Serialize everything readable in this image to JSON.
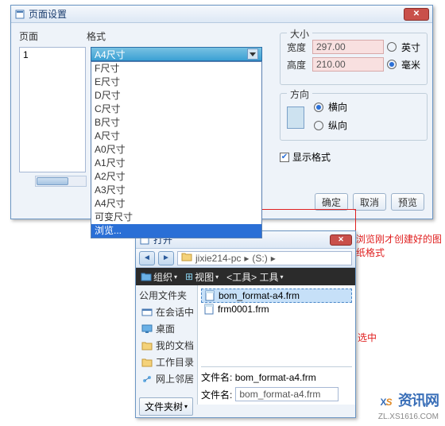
{
  "win1": {
    "title": "页面设置",
    "labels": {
      "page": "页面",
      "format": "格式"
    },
    "page_list": [
      "1"
    ],
    "selected_format": "A4尺寸",
    "dropdown": [
      "F尺寸",
      "E尺寸",
      "D尺寸",
      "C尺寸",
      "B尺寸",
      "A尺寸",
      "A0尺寸",
      "A1尺寸",
      "A2尺寸",
      "A3尺寸",
      "A4尺寸",
      "可变尺寸",
      "浏览..."
    ],
    "size": {
      "legend": "大小",
      "width_lbl": "宽度",
      "width": "297.00",
      "height_lbl": "高度",
      "height": "210.00",
      "unit_in": "英寸",
      "unit_mm": "毫米"
    },
    "orient": {
      "legend": "方向",
      "landscape": "横向",
      "portrait": "纵向"
    },
    "show_format": "显示格式",
    "buttons": {
      "ok": "确定",
      "cancel": "取消",
      "preview": "预览"
    }
  },
  "ann": {
    "a1": "浏览刚才创建好的图纸格式",
    "a2": "选中"
  },
  "win2": {
    "title": "打开",
    "path_seg": "jixie214-pc",
    "path_tail": "(S:)",
    "menu": {
      "org": "组织",
      "view": "视图",
      "tools": "<工具> 工具"
    },
    "sidebar": {
      "cat": "公用文件夹",
      "items": [
        "在会话中",
        "桌面",
        "我的文档",
        "工作目录",
        "网上邻居"
      ]
    },
    "files": [
      "bom_format-a4.frm",
      "frm0001.frm"
    ],
    "footer": {
      "label": "文件名:",
      "value": "bom_format-a4.frm",
      "label2": "文件名:",
      "value2": "bom_format-a4.frm"
    },
    "tree": "文件夹树"
  },
  "logo": {
    "cn": "资讯网",
    "url": "ZL.XS1616.COM"
  }
}
